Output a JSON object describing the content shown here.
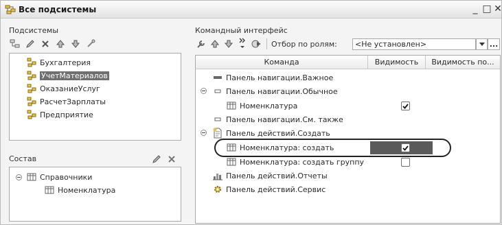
{
  "window": {
    "title": "Все подсистемы",
    "min": "_",
    "max": "□",
    "close": "✕"
  },
  "subsystems": {
    "label": "Подсистемы",
    "items": [
      "Бухгалтерия",
      "УчетМатериалов",
      "ОказаниеУслуг",
      "РасчетЗарплаты",
      "Предприятие"
    ],
    "selected_index": 1
  },
  "composition": {
    "label": "Состав",
    "items": [
      "Справочники",
      "Номенклатура"
    ]
  },
  "command_interface": {
    "label": "Командный интерфейс",
    "role_filter_label": "Отбор по ролям:",
    "role_filter_value": "<Не установлен>",
    "ellipsis": "..."
  },
  "grid": {
    "headers": [
      "Команда",
      "Видимость",
      "Видимость по..."
    ],
    "rows": [
      {
        "label": "Панель навигации.Важное",
        "checked": null
      },
      {
        "label": "Панель навигации.Обычное",
        "checked": null
      },
      {
        "label": "Номенклатура",
        "checked": true
      },
      {
        "label": "Панель навигации.См. также",
        "checked": null
      },
      {
        "label": "Панель действий.Создать",
        "checked": null
      },
      {
        "label": "Номенклатура: создать",
        "checked": true
      },
      {
        "label": "Номенклатура: создать группу",
        "checked": false
      },
      {
        "label": "Панель действий.Отчеты",
        "checked": null
      },
      {
        "label": "Панель действий.Сервис",
        "checked": null
      }
    ],
    "current_row": 5
  }
}
